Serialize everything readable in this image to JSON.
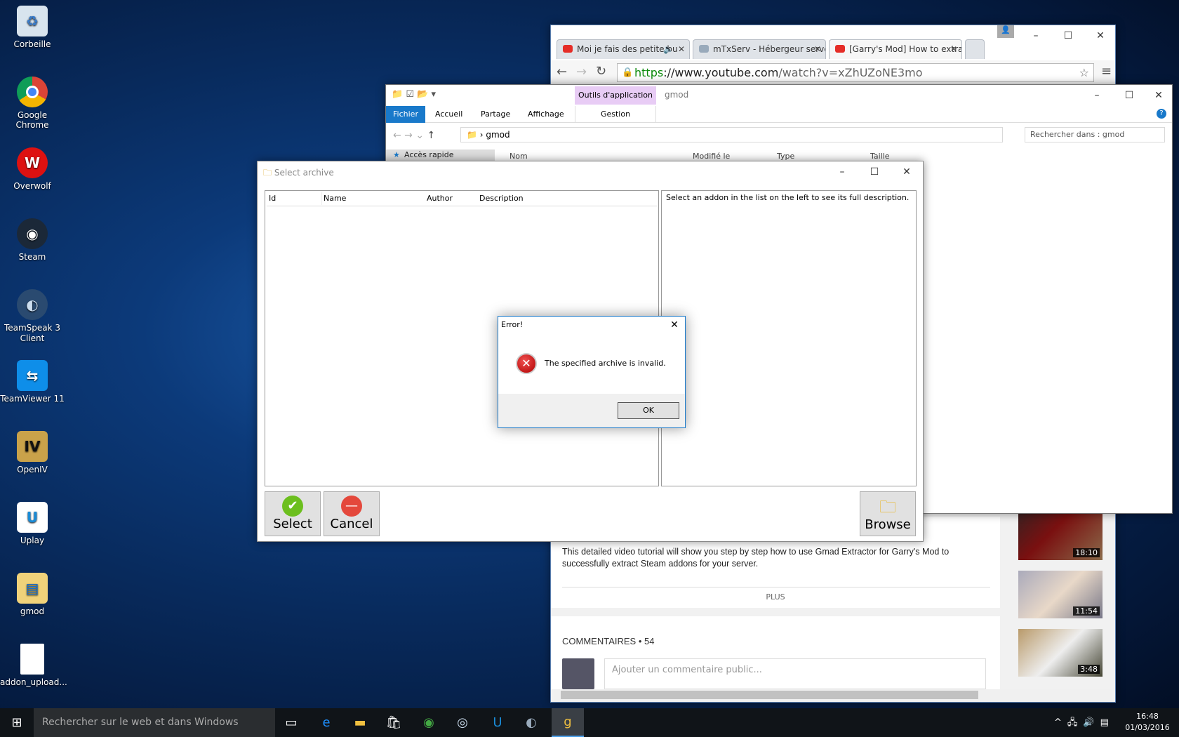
{
  "desktop": {
    "icons": [
      {
        "label": "Corbeille",
        "icon": "recycle-bin-icon"
      },
      {
        "label": "Google Chrome",
        "icon": "chrome-icon"
      },
      {
        "label": "Overwolf",
        "icon": "overwolf-icon"
      },
      {
        "label": "Steam",
        "icon": "steam-icon"
      },
      {
        "label": "TeamSpeak 3 Client",
        "icon": "teamspeak-icon"
      },
      {
        "label": "TeamViewer 11",
        "icon": "teamviewer-icon"
      },
      {
        "label": "OpenIV",
        "icon": "openiv-icon"
      },
      {
        "label": "Uplay",
        "icon": "uplay-icon"
      },
      {
        "label": "gmod",
        "icon": "folder-icon"
      },
      {
        "label": "addon_upload...",
        "icon": "file-icon"
      }
    ]
  },
  "chrome": {
    "tabs": [
      {
        "label": "Moi je fais des petite bu",
        "audio": "🔈"
      },
      {
        "label": "mTxServ - Hébergeur serve"
      },
      {
        "label": "[Garry's Mod] How to extra"
      }
    ],
    "url_scheme": "https",
    "url_host": "://www.youtube.com",
    "url_path": "/watch?v=xZhUZoNE3mo",
    "description": "This detailed video tutorial will show you step by step how to use Gmad Extractor for Garry's Mod to successfully extract Steam addons for your server.",
    "more_label": "PLUS",
    "comments_label": "COMMENTAIRES • 54",
    "comment_placeholder": "Ajouter un commentaire public...",
    "thumbs": [
      "18:10",
      "11:54",
      "3:48"
    ]
  },
  "explorer": {
    "title": "gmod",
    "context_tab": "Outils d'application",
    "context_sub": "Gestion",
    "ribbon_tabs": [
      "Fichier",
      "Accueil",
      "Partage",
      "Affichage"
    ],
    "path": "gmod",
    "search_placeholder": "Rechercher dans : gmod",
    "columns": [
      "Nom",
      "Modifié le",
      "Type",
      "Taille"
    ],
    "nav_item": "Accès rapide"
  },
  "select_archive": {
    "title": "Select archive",
    "columns": [
      "Id",
      "Name",
      "Author",
      "Description"
    ],
    "description_hint": "Select an addon in the list on the left to see its full description.",
    "select_label": "Select",
    "cancel_label": "Cancel",
    "browse_label": "Browse"
  },
  "error_dialog": {
    "title": "Error!",
    "message": "The specified archive is invalid.",
    "ok_label": "OK"
  },
  "taskbar": {
    "search_placeholder": "Rechercher sur le web et dans Windows",
    "time": "16:48",
    "date": "01/03/2016"
  },
  "colors": {
    "accent": "#1979ca",
    "error": "#c81e1e",
    "context_tab": "#e8ccf5"
  }
}
